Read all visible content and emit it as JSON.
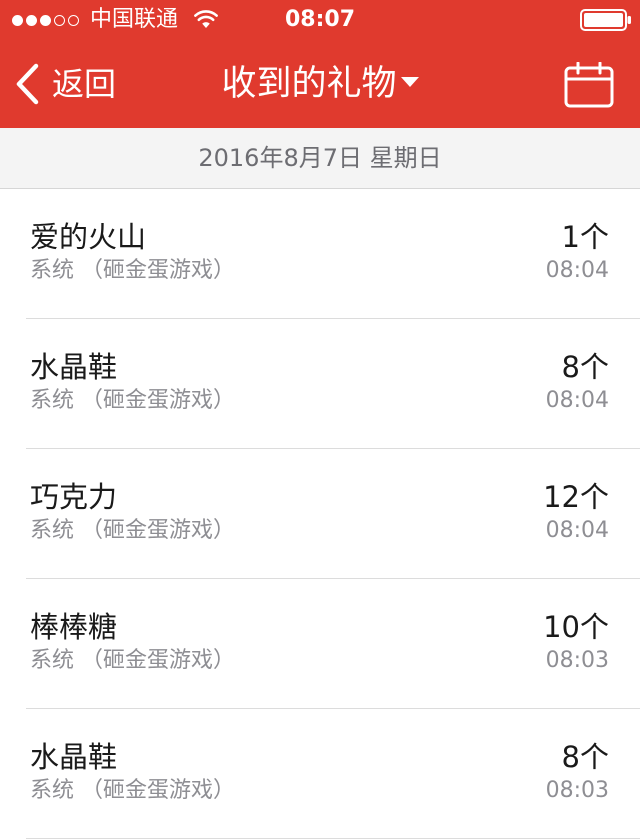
{
  "status_bar": {
    "signal_filled": 3,
    "signal_empty": 2,
    "carrier": "中国联通",
    "time": "08:07"
  },
  "nav": {
    "back_label": "返回",
    "title": "收到的礼物"
  },
  "date_label": "2016年8月7日  星期日",
  "gifts": [
    {
      "name": "爱的火山",
      "source": "系统 （砸金蛋游戏）",
      "count": "1个",
      "time": "08:04"
    },
    {
      "name": "水晶鞋",
      "source": "系统 （砸金蛋游戏）",
      "count": "8个",
      "time": "08:04"
    },
    {
      "name": "巧克力",
      "source": "系统 （砸金蛋游戏）",
      "count": "12个",
      "time": "08:04"
    },
    {
      "name": "棒棒糖",
      "source": "系统 （砸金蛋游戏）",
      "count": "10个",
      "time": "08:03"
    },
    {
      "name": "水晶鞋",
      "source": "系统 （砸金蛋游戏）",
      "count": "8个",
      "time": "08:03"
    }
  ],
  "colors": {
    "accent": "#e03a2e",
    "date_bar_bg": "#f4f4f4",
    "secondary_text": "#8e8e93"
  }
}
